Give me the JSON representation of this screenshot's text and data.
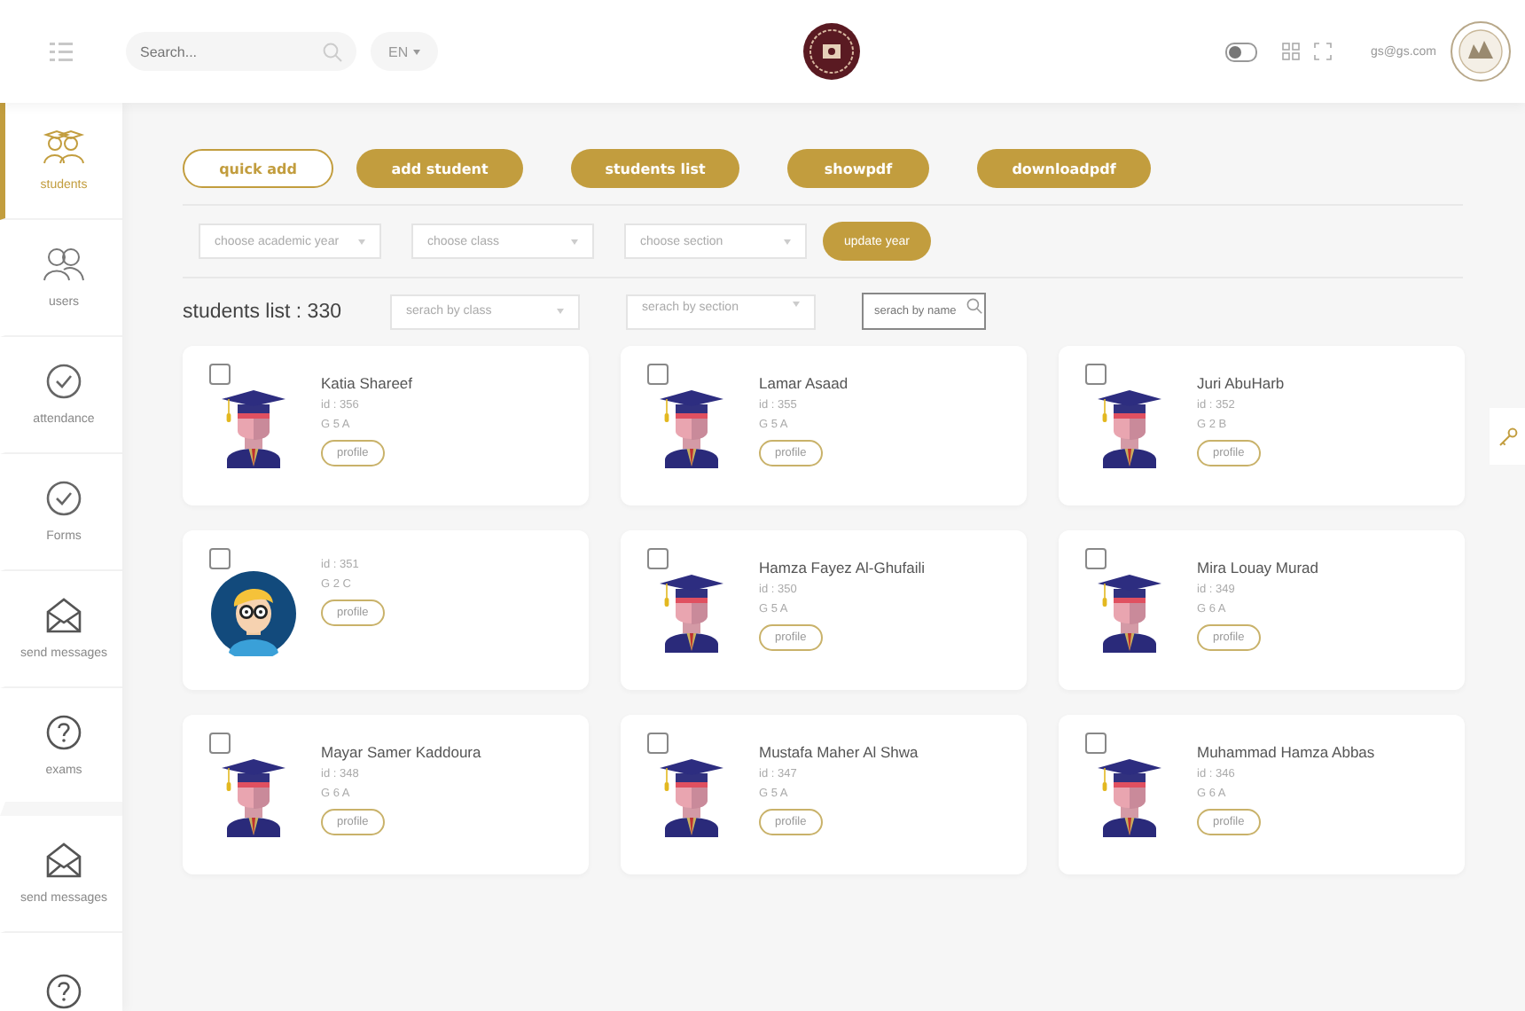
{
  "header": {
    "search": {
      "placeholder": "Search..."
    },
    "language": "EN",
    "dark_mode": {
      "on": false
    },
    "email": "gs@gs.com"
  },
  "sidebar": {
    "items": [
      {
        "kind": "students",
        "label": "students",
        "selected": true
      },
      {
        "kind": "users",
        "label": "users",
        "selected": false
      },
      {
        "kind": "check",
        "label": "attendance",
        "selected": false
      },
      {
        "kind": "check",
        "label": "Forms",
        "selected": false
      },
      {
        "kind": "mail",
        "label": "send messages",
        "selected": false
      },
      {
        "kind": "question",
        "label": "exams",
        "selected": false
      },
      {
        "kind": "mail",
        "label": "send messages",
        "selected": false
      },
      {
        "kind": "question",
        "selected": false
      }
    ]
  },
  "actions": [
    {
      "label": "quick add",
      "kind": "outline"
    },
    {
      "label": "add student",
      "kind": "filled"
    },
    {
      "label": "students list",
      "kind": "filled"
    },
    {
      "label": "showpdf",
      "kind": "filled"
    },
    {
      "label": "downloadpdf",
      "kind": "filled"
    }
  ],
  "filters": {
    "academic_year": {
      "placeholder": "choose academic year"
    },
    "class": {
      "placeholder": "choose class"
    },
    "section": {
      "placeholder": "choose section"
    },
    "update_button": "update year"
  },
  "list_header": {
    "title": "students list : 330",
    "class_filter": {
      "placeholder": "serach by class"
    },
    "section_filter": {
      "placeholder": "serach by section"
    },
    "name_search": {
      "placeholder": "serach by name"
    }
  },
  "students": [
    {
      "name": "Katia Shareef",
      "id": "id : 356",
      "grade": "G 5 A",
      "kind": "graduate",
      "checked": false,
      "button": "profile"
    },
    {
      "name": "Lamar Asaad",
      "id": "id : 355",
      "grade": "G 5 A",
      "kind": "graduate",
      "checked": false,
      "button": "profile"
    },
    {
      "name": "Juri AbuHarb",
      "id": "id : 352",
      "grade": "G 2 B",
      "kind": "graduate",
      "checked": false,
      "button": "profile"
    },
    {
      "id": "id : 351",
      "grade": "G 2 C",
      "kind": "boy",
      "checked": false,
      "button": "profile"
    },
    {
      "name": "Hamza Fayez Al-Ghufaili",
      "id": "id : 350",
      "grade": "G 5 A",
      "kind": "graduate",
      "checked": false,
      "button": "profile"
    },
    {
      "name": "Mira Louay Murad",
      "id": "id : 349",
      "grade": "G 6 A",
      "kind": "graduate",
      "checked": false,
      "button": "profile"
    },
    {
      "name": "Mayar Samer Kaddoura",
      "id": "id : 348",
      "grade": "G 6 A",
      "kind": "graduate",
      "checked": false,
      "button": "profile"
    },
    {
      "name": "Mustafa Maher Al Shwa",
      "id": "id : 347",
      "grade": "G 5 A",
      "kind": "graduate",
      "checked": false,
      "button": "profile"
    },
    {
      "name": "Muhammad Hamza Abbas",
      "id": "id : 346",
      "grade": "G 6 A",
      "kind": "graduate",
      "checked": false,
      "button": "profile"
    }
  ]
}
